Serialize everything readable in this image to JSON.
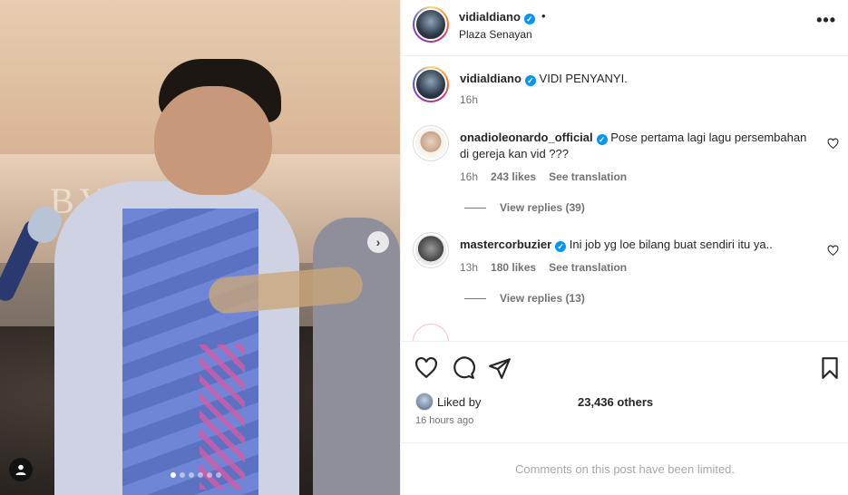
{
  "post": {
    "username": "vidialdiano",
    "location": "Plaza Senayan",
    "separator": "•",
    "more_label": "•••",
    "carousel": {
      "slides": 6,
      "current": 1
    }
  },
  "caption": {
    "username": "vidialdiano",
    "text": "VIDI PENYANYI.",
    "time": "16h"
  },
  "comments": [
    {
      "username": "onadioleonardo_official",
      "text": "Pose pertama lagi lagu persembahan di gereja kan vid ???",
      "time": "16h",
      "likes": "243 likes",
      "translate": "See translation",
      "replies": "View replies (39)"
    },
    {
      "username": "mastercorbuzier",
      "text": "Ini job yg loe bilang buat sendiri itu ya..",
      "time": "13h",
      "likes": "180 likes",
      "translate": "See translation",
      "replies": "View replies (13)"
    }
  ],
  "likes": {
    "prefix": "Liked by",
    "others": "23,436 others"
  },
  "timestamp": "16 hours ago",
  "comments_limited": "Comments on this post have been limited.",
  "icons": {
    "verified": "verified-check-icon",
    "like": "heart-icon",
    "comment": "comment-bubble-icon",
    "share": "paper-plane-icon",
    "save": "bookmark-icon"
  },
  "colors": {
    "verified": "#0095f6",
    "muted": "#737373",
    "text": "#262626"
  }
}
